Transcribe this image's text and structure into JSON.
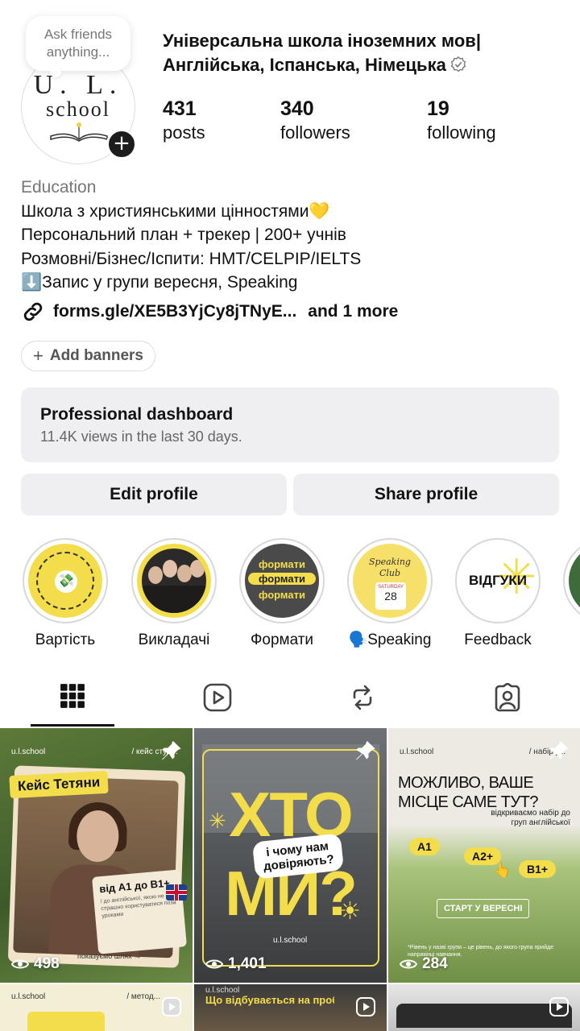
{
  "note": {
    "text": "Ask friends anything..."
  },
  "profile": {
    "name": "Універсальна школа іноземних мов| Англійська, Іспанська, Німецька",
    "avatar_line1": "U. L.",
    "avatar_line2": "school"
  },
  "stats": {
    "posts_count": "431",
    "posts_label": "posts",
    "followers_count": "340",
    "followers_label": "followers",
    "following_count": "19",
    "following_label": "following"
  },
  "bio": {
    "category": "Education",
    "line1": "Школа з християнськими цінностями💛",
    "line2": "Персональний план + трекер | 200+ учнів",
    "line3": "Розмовні/Бізнес/Іспити: НМТ/CELPIP/IELTS",
    "line4": "⬇️Запис у групи вересня, Speaking",
    "link": "forms.gle/XE5B3YjCy8jTNyE...",
    "link_more": "and 1 more",
    "add_banners": "Add banners"
  },
  "dashboard": {
    "title": "Professional dashboard",
    "subtitle": "11.4K views in the last 30 days."
  },
  "buttons": {
    "edit": "Edit profile",
    "share": "Share profile"
  },
  "highlights": [
    {
      "label": "Вартість"
    },
    {
      "label": "Викладачі"
    },
    {
      "label": "Формати",
      "cover_text": "формати"
    },
    {
      "label": "🗣️Speaking",
      "cover_text": "Speaking Club",
      "cover_day": "SATURDAY",
      "cover_date": "28"
    },
    {
      "label": "Feedback",
      "cover_text": "ВІДГУКИ"
    }
  ],
  "tabs": [
    "grid-icon",
    "reels-icon",
    "reposts-icon",
    "tagged-icon"
  ],
  "posts": [
    {
      "brand": "u.l.school",
      "tag": "/ кейс студ...",
      "title": "Кейс Тетяни",
      "badge": "від А1 до В1+",
      "badge_sub": "/ до англійської, якою не страшно користуватися поза уроками",
      "footer": "показуємо шлях →",
      "views": "498"
    },
    {
      "headline1": "ХТО",
      "headline2": "МИ?",
      "bubble": "і чому нам довіряють?",
      "brand": "u.l.school",
      "views": "1,401"
    },
    {
      "brand": "u.l.school",
      "tag": "/ набір у...",
      "headline": "МОЖЛИВО, ВАШЕ МІСЦЕ САМЕ ТУТ?",
      "sub": "відкриваємо набір до груп англійської",
      "levels": [
        "A1",
        "A2+",
        "B1+"
      ],
      "cta": "СТАРТ У ВЕРЕСНІ",
      "footnote": "*Рівень у назві групи – це рівень, до якого група прийде наприкінці навчання.",
      "views": "284"
    },
    {
      "brand": "u.l.school",
      "tag": "/ метод..."
    },
    {
      "brand": "u.l.school",
      "headline": "Що відбувається на пробному..."
    },
    {}
  ]
}
